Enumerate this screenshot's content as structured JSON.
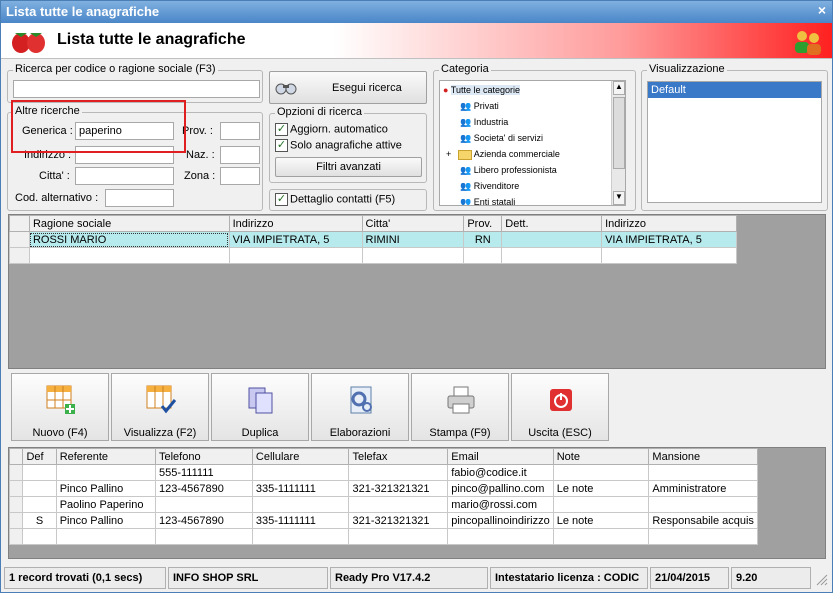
{
  "window": {
    "title": "Lista tutte le anagrafiche",
    "close_glyph": "×"
  },
  "header": {
    "title": "Lista tutte le anagrafiche"
  },
  "search": {
    "legend": "Ricerca per codice o ragione sociale (F3)",
    "value": "",
    "search_button": "Esegui ricerca"
  },
  "other": {
    "legend": "Altre ricerche",
    "generica_label": "Generica :",
    "generica_value": "paperino",
    "indirizzo_label": "Indirizzo :",
    "citta_label": "Citta' :",
    "codalt_label": "Cod. alternativo :",
    "prov_label": "Prov. :",
    "naz_label": "Naz. :",
    "zona_label": "Zona :"
  },
  "options": {
    "legend": "Opzioni di ricerca",
    "aggiorn": "Aggiorn. automatico",
    "solo_attive": "Solo anagrafiche attive",
    "filtri": "Filtri avanzati",
    "dettaglio": "Dettaglio contatti (F5)",
    "check_glyph": "✓"
  },
  "categoria": {
    "legend": "Categoria",
    "items": [
      "Tutte le categorie",
      "Privati",
      "Industria",
      "Societa' di servizi",
      "Azienda commerciale",
      "Libero professionista",
      "Rivenditore",
      "Enti statali"
    ],
    "expander": "+"
  },
  "visual": {
    "legend": "Visualizzazione",
    "items": [
      "Default"
    ]
  },
  "main_table": {
    "headers": [
      "Ragione sociale",
      "Indirizzo",
      "Citta'",
      "Prov.",
      "Dett.",
      "Indirizzo"
    ],
    "rows": [
      [
        "ROSSI MARIO",
        "VIA IMPIETRATA, 5",
        "RIMINI",
        "RN",
        "",
        "VIA IMPIETRATA, 5"
      ]
    ]
  },
  "toolbar": {
    "nuovo": "Nuovo (F4)",
    "visualizza": "Visualizza (F2)",
    "duplica": "Duplica",
    "elaborazioni": "Elaborazioni",
    "stampa": "Stampa (F9)",
    "uscita": "Uscita (ESC)"
  },
  "contacts": {
    "headers": [
      "Def",
      "Referente",
      "Telefono",
      "Cellulare",
      "Telefax",
      "Email",
      "Note",
      "Mansione"
    ],
    "rows": [
      [
        "",
        "",
        "555-111111",
        "",
        "",
        "fabio@codice.it",
        "",
        ""
      ],
      [
        "",
        "Pinco Pallino",
        "123-4567890",
        "335-1111111",
        "321-321321321",
        "pinco@pallino.com",
        "Le note",
        "Amministratore"
      ],
      [
        "",
        "Paolino Paperino",
        "",
        "",
        "",
        "mario@rossi.com",
        "",
        ""
      ],
      [
        "S",
        "Pinco Pallino",
        "123-4567890",
        "335-1111111",
        "321-321321321",
        "pincopallinoindirizzo",
        "Le note",
        "Responsabile acquis"
      ]
    ]
  },
  "status": {
    "records": "1 record trovati (0,1 secs)",
    "company": "INFO SHOP SRL",
    "version": "Ready Pro V17.4.2",
    "license": "Intestatario licenza : CODIC",
    "date": "21/04/2015",
    "time": "9.20"
  },
  "colors": {
    "accent": "#4a86c8",
    "selected_row": "#b7eaec",
    "highlight_box": "#e02020"
  }
}
